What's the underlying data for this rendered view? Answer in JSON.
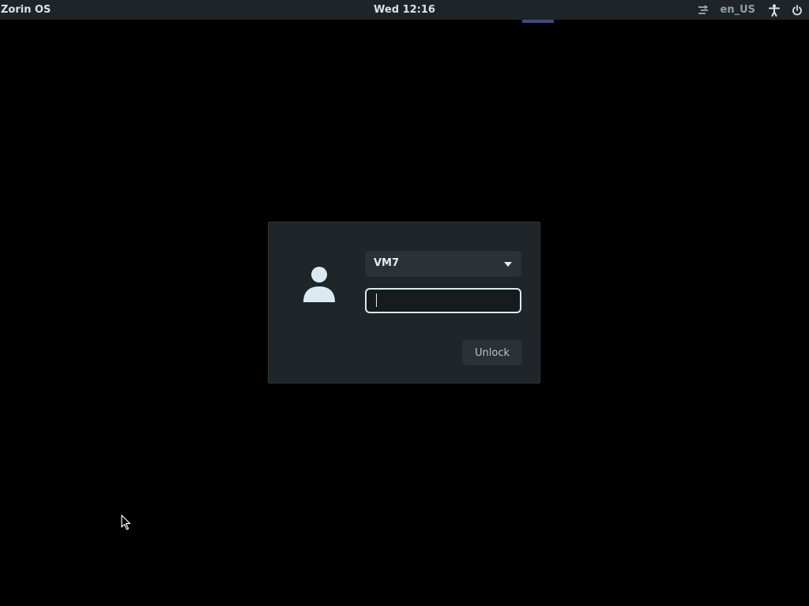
{
  "topbar": {
    "brand": "Zorin OS",
    "clock": "Wed 12:16",
    "tray": {
      "network_icon": "network-icon",
      "keyboard_layout": "en_US",
      "accessibility_icon": "accessibility-icon",
      "power_icon": "power-icon"
    }
  },
  "lock_dialog": {
    "avatar_icon": "user-avatar-icon",
    "user_select": {
      "selected_value": "VM7",
      "arrow_icon": "dropdown-arrow-icon"
    },
    "password": {
      "value": "",
      "placeholder": ""
    },
    "unlock_label": "Unlock"
  },
  "colors": {
    "background": "#000000",
    "topbar": "#1e2428",
    "dialog": "#1f2529",
    "field_border": "#d9eaf2",
    "focus_indicator": "#3f4a7f",
    "accent_text": "#d6e4ec"
  },
  "pointer_icon": "mouse-pointer-icon"
}
